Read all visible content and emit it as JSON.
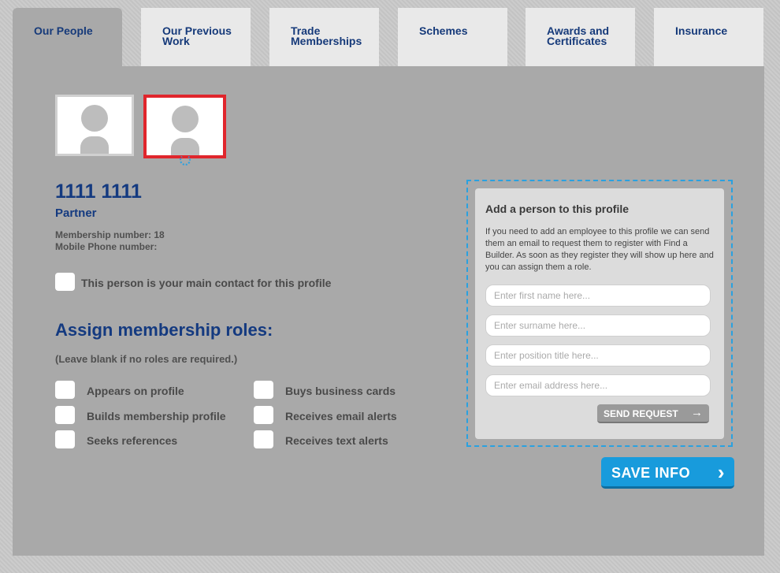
{
  "tabs": [
    {
      "label": "Our People",
      "active": true
    },
    {
      "label": "Our Previous Work"
    },
    {
      "label": "Trade Memberships"
    },
    {
      "label": "Schemes"
    },
    {
      "label": "Awards and Certificates"
    },
    {
      "label": "Insurance"
    }
  ],
  "person": {
    "name": "1111 1111",
    "role": "Partner",
    "membership_number": "Membership number: 18",
    "mobile_phone": "Mobile Phone number:",
    "main_contact_label": "This person is your main contact for this profile"
  },
  "roles": {
    "title": "Assign membership roles:",
    "note": "(Leave blank if no roles are required.)",
    "items": [
      "Appears on profile",
      "Builds membership profile",
      "Seeks references",
      "Buys business cards",
      "Receives email alerts",
      "Receives text alerts"
    ]
  },
  "add_person": {
    "title": "Add a person to this profile",
    "description": "If you need to add an employee to this profile we can send them an email to request them to register with Find a Builder. As soon as they register they will show up here and you can assign them a role.",
    "first_name_placeholder": "Enter first name here...",
    "surname_placeholder": "Enter surname here...",
    "position_placeholder": "Enter position title here...",
    "email_placeholder": "Enter email address here...",
    "send_label": "SEND REQUEST",
    "send_icon": "arrow-right-icon"
  },
  "save": {
    "label": "SAVE INFO",
    "icon": "chevron-right-icon"
  },
  "colors": {
    "accent": "#189bdc",
    "brand_text": "#143a80",
    "selected_border": "#e0262c"
  }
}
